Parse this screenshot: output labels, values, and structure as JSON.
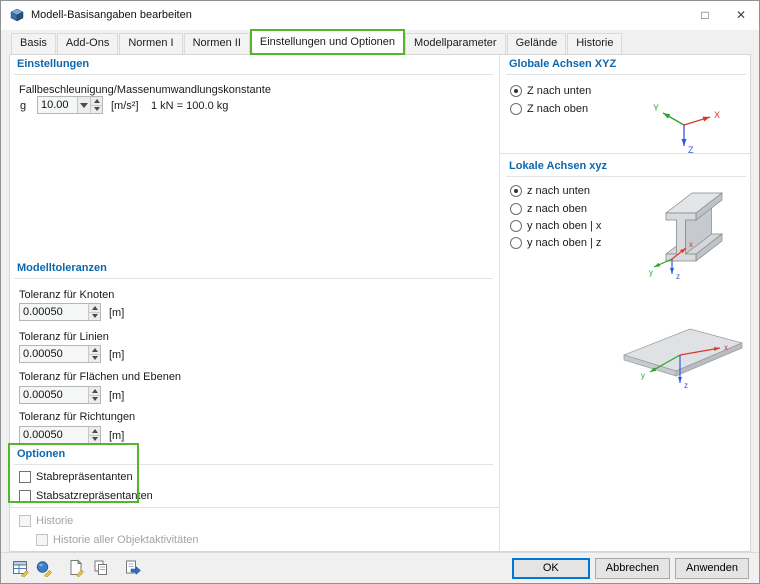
{
  "window": {
    "title": "Modell-Basisangaben bearbeiten",
    "controls": {
      "maximize": "□",
      "close": "✕"
    }
  },
  "tabs": {
    "items": [
      {
        "label": "Basis",
        "active": false
      },
      {
        "label": "Add-Ons",
        "active": false
      },
      {
        "label": "Normen I",
        "active": false
      },
      {
        "label": "Normen II",
        "active": false
      },
      {
        "label": "Einstellungen und Optionen",
        "active": true,
        "highlighted": true
      },
      {
        "label": "Modellparameter",
        "active": false
      },
      {
        "label": "Gelände",
        "active": false
      },
      {
        "label": "Historie",
        "active": false
      }
    ]
  },
  "settings": {
    "title": "Einstellungen",
    "gravity_label": "Fallbeschleunigung/Massenumwandlungskonstante",
    "g_symbol": "g",
    "g_value": "10.00",
    "g_unit": "[m/s²]",
    "conversion_note": "1 kN = 100.0 kg"
  },
  "tolerances": {
    "title": "Modelltoleranzen",
    "rows": [
      {
        "label": "Toleranz für Knoten",
        "value": "0.00050",
        "unit": "[m]"
      },
      {
        "label": "Toleranz für Linien",
        "value": "0.00050",
        "unit": "[m]"
      },
      {
        "label": "Toleranz für Flächen und Ebenen",
        "value": "0.00050",
        "unit": "[m]"
      },
      {
        "label": "Toleranz für Richtungen",
        "value": "0.00050",
        "unit": "[m]"
      }
    ]
  },
  "options": {
    "title": "Optionen",
    "checkboxes": [
      {
        "label": "Stabrepräsentanten",
        "checked": false
      },
      {
        "label": "Stabsatzrepräsentanten",
        "checked": false
      }
    ],
    "history": {
      "label": "Historie",
      "checked": false,
      "disabled": true
    },
    "history_all": {
      "label": "Historie aller Objektaktivitäten",
      "checked": false,
      "disabled": true
    }
  },
  "global_axes": {
    "title": "Globale Achsen XYZ",
    "options": [
      {
        "label": "Z nach unten",
        "selected": true
      },
      {
        "label": "Z nach oben",
        "selected": false
      }
    ]
  },
  "local_axes": {
    "title": "Lokale Achsen xyz",
    "options": [
      {
        "label": "z nach unten",
        "selected": true
      },
      {
        "label": "z nach oben",
        "selected": false
      },
      {
        "label": "y nach oben | x",
        "selected": false
      },
      {
        "label": "y nach oben | z",
        "selected": false
      }
    ]
  },
  "axes": {
    "global": {
      "x": "X",
      "y": "Y",
      "z": "Z"
    },
    "local": {
      "x": "x",
      "y": "y",
      "z": "z"
    }
  },
  "footer": {
    "buttons": {
      "ok": "OK",
      "cancel": "Abbrechen",
      "apply": "Anwenden"
    },
    "toolbar_icons": [
      "units-decimals-icon",
      "comment-icon",
      "edit-page-icon",
      "copy-icon",
      "paste-icon"
    ]
  },
  "colors": {
    "section_title": "#0d67ad",
    "annotation_green": "#55b42d",
    "focus_blue": "#0078d7",
    "axis_x": "#d93a2b",
    "axis_y": "#2ba32b",
    "axis_z": "#2b5cd9"
  }
}
